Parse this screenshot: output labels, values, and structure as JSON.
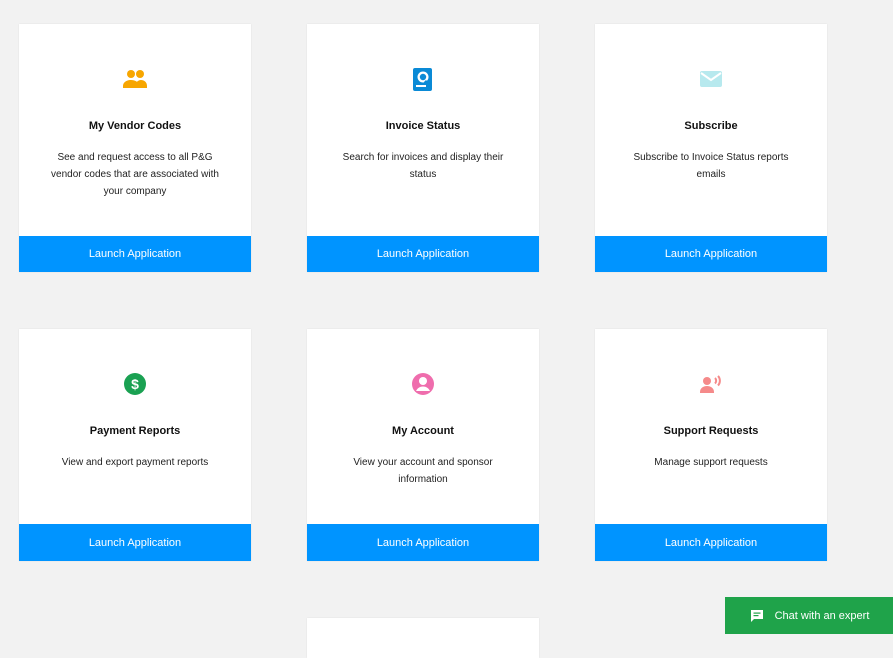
{
  "cards": [
    {
      "title": "My Vendor Codes",
      "desc": "See and request access to all P&G vendor codes that are associated with your company",
      "button": "Launch Application",
      "icon": "users-icon",
      "color": "#f7a600"
    },
    {
      "title": "Invoice Status",
      "desc": "Search for invoices and display their status",
      "button": "Launch Application",
      "icon": "invoice-search-icon",
      "color": "#0a8ad6"
    },
    {
      "title": "Subscribe",
      "desc": "Subscribe to Invoice Status reports emails",
      "button": "Launch Application",
      "icon": "mail-icon",
      "color": "#b7e9ee"
    },
    {
      "title": "Payment Reports",
      "desc": "View and export payment reports",
      "button": "Launch Application",
      "icon": "dollar-icon",
      "color": "#1aa152"
    },
    {
      "title": "My Account",
      "desc": "View your account and sponsor information",
      "button": "Launch Application",
      "icon": "account-icon",
      "color": "#ef6dad"
    },
    {
      "title": "Support Requests",
      "desc": "Manage support requests",
      "button": "Launch Application",
      "icon": "support-icon",
      "color": "#f58a8a"
    }
  ],
  "chat": {
    "label": "Chat with an expert",
    "icon": "chat-icon",
    "color": "#1fa34a"
  },
  "accent_color": "#0094ff"
}
